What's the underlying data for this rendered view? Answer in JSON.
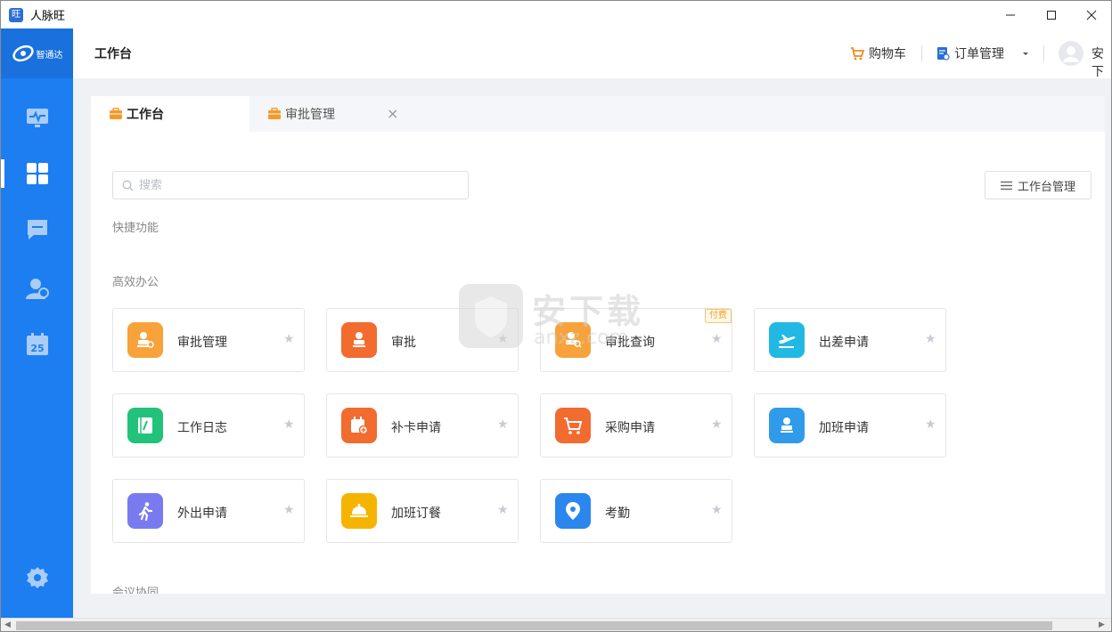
{
  "window": {
    "title": "人脉旺",
    "app_icon": "旺"
  },
  "sidebar": {
    "logo_text": "智通达",
    "items": [
      {
        "name": "dashboard-icon",
        "active": false
      },
      {
        "name": "apps-grid-icon",
        "active": true
      },
      {
        "name": "message-icon",
        "active": false
      },
      {
        "name": "contacts-icon",
        "active": false
      },
      {
        "name": "calendar-icon",
        "active": false,
        "day": "25"
      }
    ],
    "settings_icon": "gear-icon"
  },
  "header": {
    "title": "工作台",
    "cart_label": "购物车",
    "orders_label": "订单管理",
    "user_name": "安下"
  },
  "tabs": [
    {
      "label": "工作台",
      "active": true
    },
    {
      "label": "审批管理",
      "active": false,
      "close": "×"
    }
  ],
  "search": {
    "placeholder": "搜索",
    "value": ""
  },
  "manage_button": "工作台管理",
  "sections": {
    "quick": "快捷功能",
    "office": "高效办公",
    "meeting": "会议协同"
  },
  "cards": [
    {
      "label": "审批管理",
      "color": "#f7a23a",
      "icon": "stamp-settings-icon"
    },
    {
      "label": "审批",
      "color": "#f26b2f",
      "icon": "stamp-icon"
    },
    {
      "label": "审批查询",
      "color": "#f7a23a",
      "icon": "stamp-search-icon",
      "badge": "付费"
    },
    {
      "label": "出差申请",
      "color": "#22b8e4",
      "icon": "plane-icon"
    },
    {
      "label": "工作日志",
      "color": "#22c27a",
      "icon": "notebook-icon"
    },
    {
      "label": "补卡申请",
      "color": "#f26b2f",
      "icon": "calendar-add-icon"
    },
    {
      "label": "采购申请",
      "color": "#f26b2f",
      "icon": "shopping-cart-icon"
    },
    {
      "label": "加班申请",
      "color": "#2f9bea",
      "icon": "overtime-stamp-icon"
    },
    {
      "label": "外出申请",
      "color": "#7a7af0",
      "icon": "walking-icon"
    },
    {
      "label": "加班订餐",
      "color": "#f5b400",
      "icon": "meal-cover-icon"
    },
    {
      "label": "考勤",
      "color": "#2b86ee",
      "icon": "location-pin-icon"
    }
  ],
  "watermark": {
    "text": "安下载",
    "sub": "anxz.com"
  }
}
